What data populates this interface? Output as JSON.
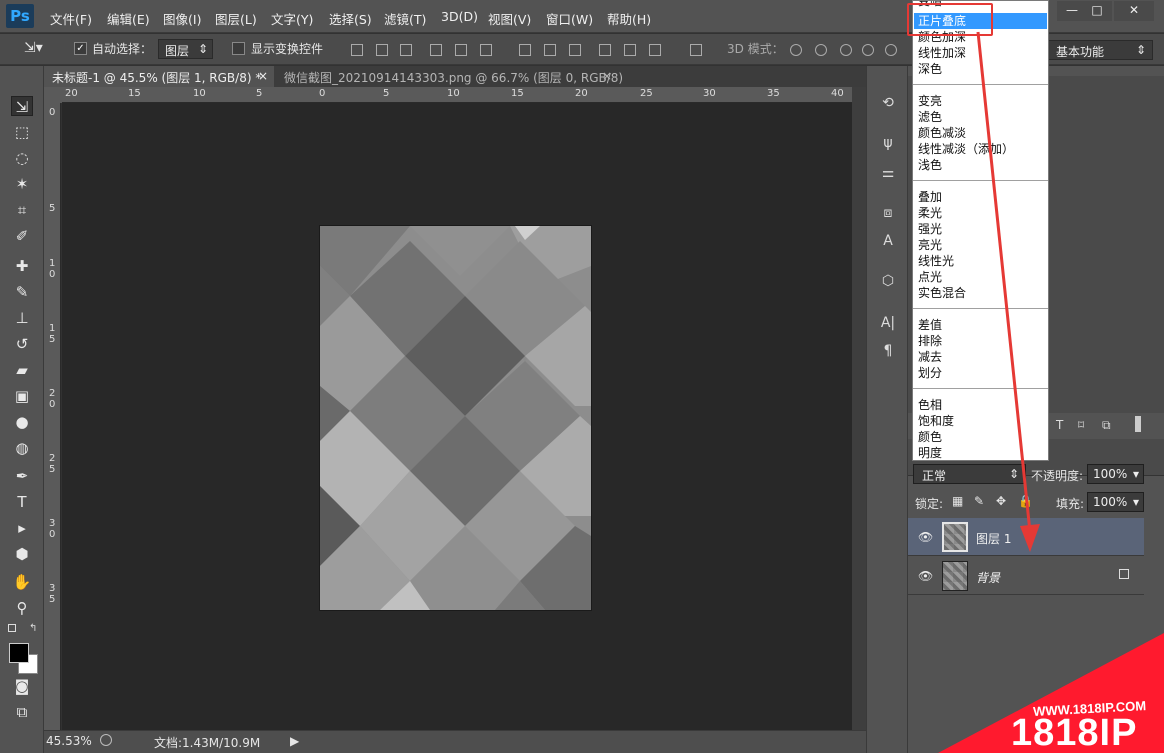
{
  "app": {
    "logo": "Ps"
  },
  "menu": [
    "文件(F)",
    "编辑(E)",
    "图像(I)",
    "图层(L)",
    "文字(Y)",
    "选择(S)",
    "滤镜(T)",
    "3D(D)",
    "视图(V)",
    "窗口(W)",
    "帮助(H)"
  ],
  "window_controls": {
    "minimize": "—",
    "maximize": "□",
    "close": "✕"
  },
  "options": {
    "auto_select_label": "自动选择：",
    "auto_select_checked": true,
    "auto_select_target": "图层",
    "show_transform_label": "显示变换控件",
    "mode_3d_label": "3D 模式：",
    "workspace": "基本功能"
  },
  "tabs": [
    {
      "label": "未标题-1 @ 45.5% (图层 1, RGB/8) *",
      "close": "×"
    },
    {
      "label": "微信截图_20210914143303.png @ 66.7% (图层 0, RGB/8)",
      "close": "×"
    }
  ],
  "ruler_h": [
    "20",
    "15",
    "10",
    "5",
    "0",
    "5",
    "10",
    "15",
    "20",
    "25",
    "30",
    "35",
    "40"
  ],
  "ruler_v": [
    "0",
    "5",
    "1\n0",
    "1\n5",
    "2\n0",
    "2\n5",
    "3\n0",
    "3\n5"
  ],
  "status": {
    "zoom": "45.53%",
    "doc_info": "文档:1.43M/10.9M"
  },
  "blend_modes": {
    "partial_top": "变暗",
    "groups": [
      [
        "正片叠底",
        "颜色加深",
        "线性加深",
        "深色"
      ],
      [
        "变亮",
        "滤色",
        "颜色减淡",
        "线性减淡（添加）",
        "浅色"
      ],
      [
        "叠加",
        "柔光",
        "强光",
        "亮光",
        "线性光",
        "点光",
        "实色混合"
      ],
      [
        "差值",
        "排除",
        "减去",
        "划分"
      ],
      [
        "色相",
        "饱和度",
        "颜色",
        "明度"
      ]
    ],
    "highlighted": "正片叠底"
  },
  "layers_panel": {
    "blend_mode": "正常",
    "opacity_label": "不透明度:",
    "opacity": "100%",
    "lock_label": "锁定:",
    "fill_label": "填充:",
    "fill": "100%",
    "layers": [
      {
        "name": "图层 1",
        "selected": true,
        "italic": false,
        "locked": false
      },
      {
        "name": "背景",
        "selected": false,
        "italic": true,
        "locked": true
      }
    ]
  },
  "watermark": {
    "url": "WWW.1818IP.COM",
    "brand": "1818IP"
  },
  "colors": {
    "highlight": "#3399ff",
    "annotation": "#e53935",
    "selected_layer": "#5a6478"
  }
}
